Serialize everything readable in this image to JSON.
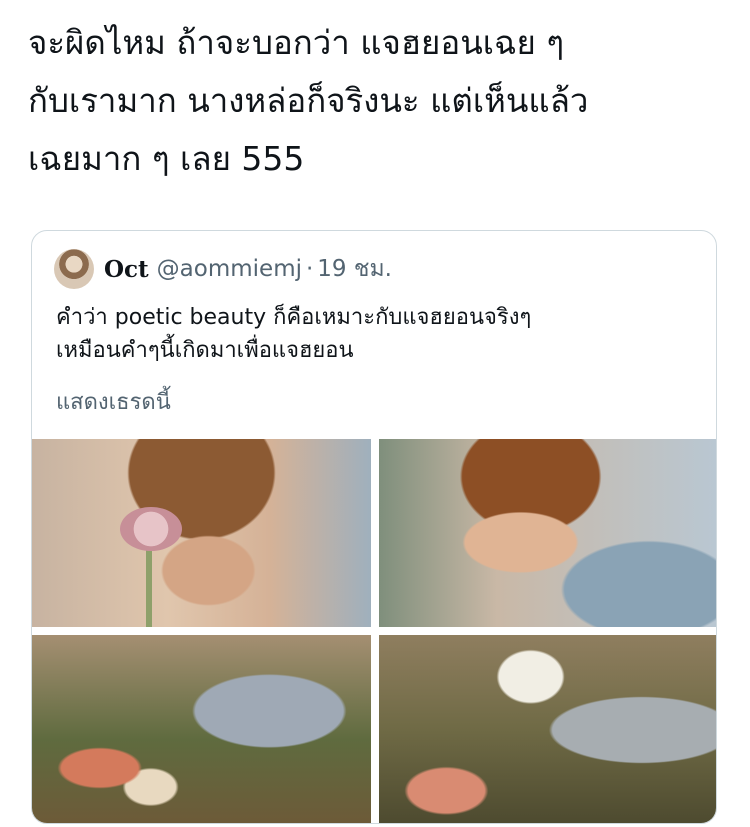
{
  "tweet": {
    "text": "จะผิดไหม ถ้าจะบอกว่า แจฮยอนเฉย ๆ\nกับเรามาก นางหล่อก็จริงนะ แต่เห็นแล้ว\nเฉยมาก ๆ เลย 555"
  },
  "quoted_tweet": {
    "author_name": "Oct",
    "author_handle": "@aommiemj",
    "separator": "·",
    "time": "19 ชม.",
    "body": "คำว่า poetic beauty ก็คือเหมาะกับแจฮยอนจริงๆ\nเหมือนคำๆนี้เกิดมาเพื่อแจฮยอน",
    "show_thread": "แสดงเธรดนี้"
  },
  "colors": {
    "text": "#0f1419",
    "secondary": "#536471",
    "border": "#cfd9de"
  }
}
